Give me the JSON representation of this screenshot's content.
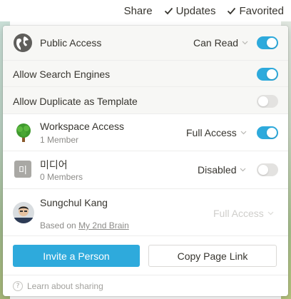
{
  "topbar": {
    "share": "Share",
    "updates": "Updates",
    "favorited": "Favorited"
  },
  "public_access": {
    "label": "Public Access",
    "permission": "Can Read",
    "enabled": true
  },
  "search_engines": {
    "label": "Allow Search Engines",
    "enabled": true
  },
  "duplicate_template": {
    "label": "Allow Duplicate as Template",
    "enabled": false
  },
  "workspace_access": {
    "label": "Workspace Access",
    "members": "1 Member",
    "permission": "Full Access",
    "enabled": true
  },
  "group": {
    "initial": "미",
    "label": "미디어",
    "members": "0 Members",
    "permission": "Disabled",
    "enabled": false
  },
  "user": {
    "name": "Sungchul Kang",
    "based_on_prefix": "Based on",
    "based_on_link": "My 2nd Brain",
    "permission": "Full Access"
  },
  "actions": {
    "invite": "Invite a Person",
    "copy_link": "Copy Page Link"
  },
  "footer": {
    "help_text": "Learn about sharing",
    "help_icon": "?"
  },
  "colors": {
    "accent": "#2eaadc",
    "text": "#37352f",
    "muted": "#8c8b88"
  }
}
